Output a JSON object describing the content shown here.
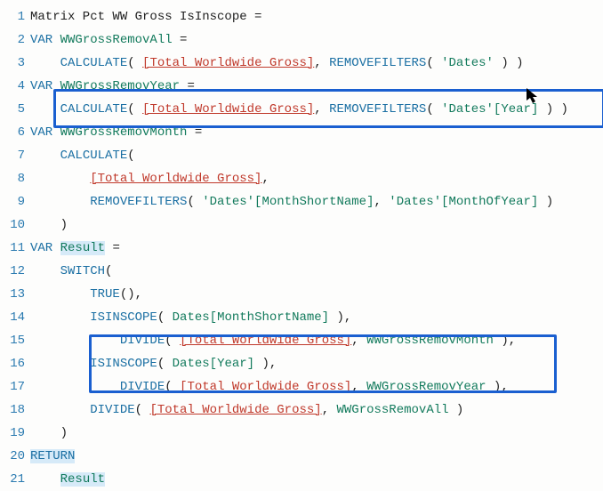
{
  "gutter": [
    "1",
    "2",
    "3",
    "4",
    "5",
    "6",
    "7",
    "8",
    "9",
    "10",
    "11",
    "12",
    "13",
    "14",
    "15",
    "16",
    "17",
    "18",
    "19",
    "20",
    "21"
  ],
  "code": {
    "l1": {
      "a": "Matrix Pct WW Gross IsInscope ="
    },
    "l2": {
      "a": "VAR",
      "b": " WWGrossRemovAll",
      "c": " ="
    },
    "l3": {
      "a": "    ",
      "b": "CALCULATE",
      "c": "( ",
      "d": "[Total Worldwide Gross]",
      "e": ", ",
      "f": "REMOVEFILTERS",
      "g": "( ",
      "h": "'Dates'",
      "i": " ) )"
    },
    "l4": {
      "a": "VAR",
      "b": " WWGrossRemovYear",
      "c": " ="
    },
    "l5": {
      "a": "    ",
      "b": "CALCULATE",
      "c": "( ",
      "d": "[Total Worldwide Gross]",
      "e": ", ",
      "f": "REMOVEFILTERS",
      "g": "( ",
      "h": "'Dates'[Year]",
      "i": " ) )"
    },
    "l6": {
      "a": "VAR",
      "b": " WWGrossRemovMonth",
      "c": " ="
    },
    "l7": {
      "a": "    ",
      "b": "CALCULATE",
      "c": "("
    },
    "l8": {
      "a": "        ",
      "b": "[Total Worldwide Gross]",
      "c": ","
    },
    "l9": {
      "a": "        ",
      "b": "REMOVEFILTERS",
      "c": "( ",
      "d": "'Dates'[MonthShortName]",
      "e": ", ",
      "f": "'Dates'[MonthOfYear]",
      "g": " )"
    },
    "l10": {
      "a": "    )"
    },
    "l11": {
      "a": "VAR",
      "b": " ",
      "c": "Result",
      "d": " ="
    },
    "l12": {
      "a": "    ",
      "b": "SWITCH",
      "c": "("
    },
    "l13": {
      "a": "        ",
      "b": "TRUE",
      "c": "(),"
    },
    "l14": {
      "a": "        ",
      "b": "ISINSCOPE",
      "c": "( ",
      "d": "Dates[MonthShortName]",
      "e": " ),"
    },
    "l15": {
      "a": "            ",
      "b": "DIVIDE",
      "c": "( ",
      "d": "[Total Worldwide Gross]",
      "e": ", ",
      "f": "WWGrossRemovMonth",
      "g": " ),"
    },
    "l16": {
      "a": "        ",
      "b": "ISINSCOPE",
      "c": "( ",
      "d": "Dates[Year]",
      "e": " ),"
    },
    "l17": {
      "a": "            ",
      "b": "DIVIDE",
      "c": "( ",
      "d": "[Total Worldwide Gross]",
      "e": ", ",
      "f": "WWGrossRemovYear",
      "g": " ),"
    },
    "l18": {
      "a": "        ",
      "b": "DIVIDE",
      "c": "( ",
      "d": "[Total Worldwide Gross]",
      "e": ", ",
      "f": "WWGrossRemovAll",
      "g": " )"
    },
    "l19": {
      "a": "    )"
    },
    "l20": {
      "a": "RETURN"
    },
    "l21": {
      "a": "    ",
      "b": "Result"
    }
  }
}
